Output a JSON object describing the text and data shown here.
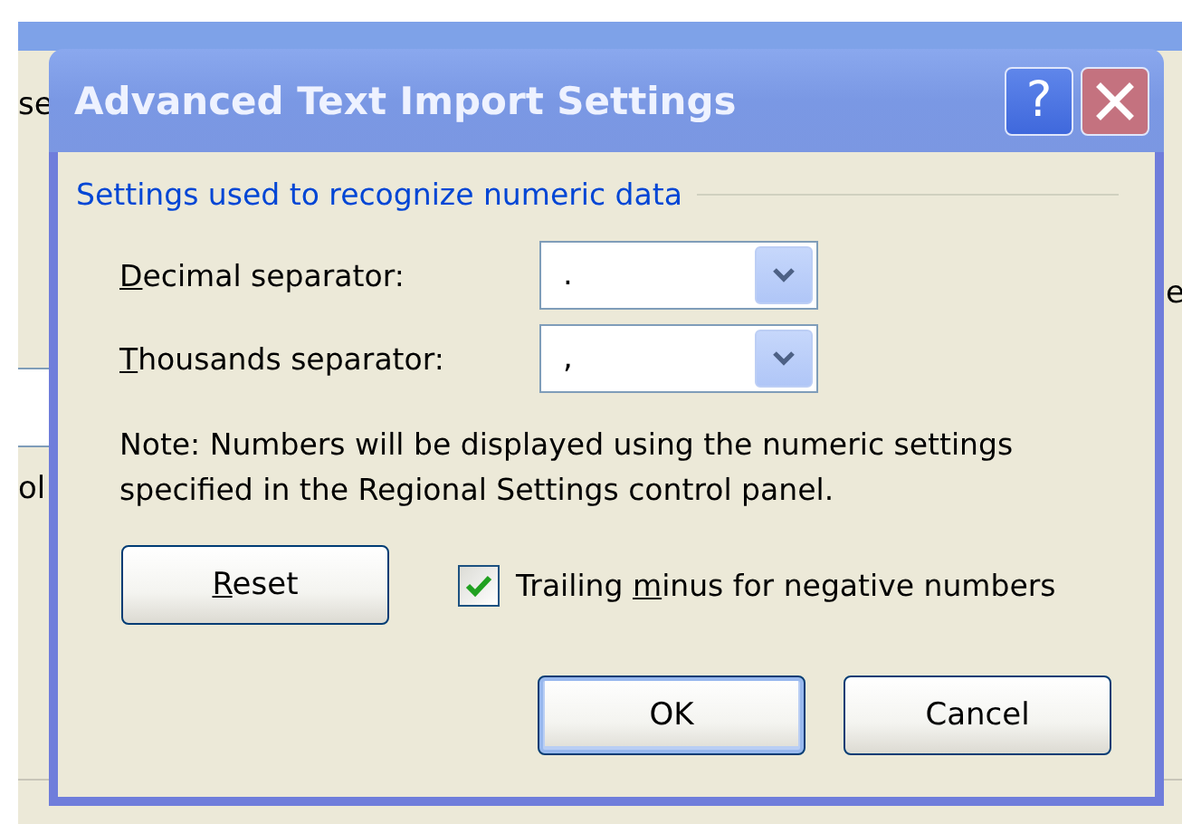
{
  "background_window": {
    "fragments": [
      {
        "text": "se"
      },
      {
        "text": "ol"
      },
      {
        "text": "e"
      }
    ]
  },
  "dialog": {
    "title": "Advanced Text Import Settings",
    "help_button": {
      "label": "?"
    },
    "group": {
      "title": "Settings used to recognize numeric data"
    },
    "fields": [
      {
        "label": {
          "key": "D",
          "after": "ecimal separator:"
        },
        "value": "."
      },
      {
        "label": {
          "key": "T",
          "after": "housands separator:"
        },
        "value": ","
      }
    ],
    "note": "Note: Numbers will be displayed using the numeric settings specified in the Regional Settings control panel.",
    "reset_button": {
      "key": "R",
      "after": "eset"
    },
    "checkbox": {
      "before": "Trailing ",
      "key": "m",
      "after": "inus for negative numbers",
      "checked": true
    },
    "buttons": [
      {
        "label": "OK",
        "default": true
      },
      {
        "label": "Cancel",
        "default": false
      }
    ]
  }
}
